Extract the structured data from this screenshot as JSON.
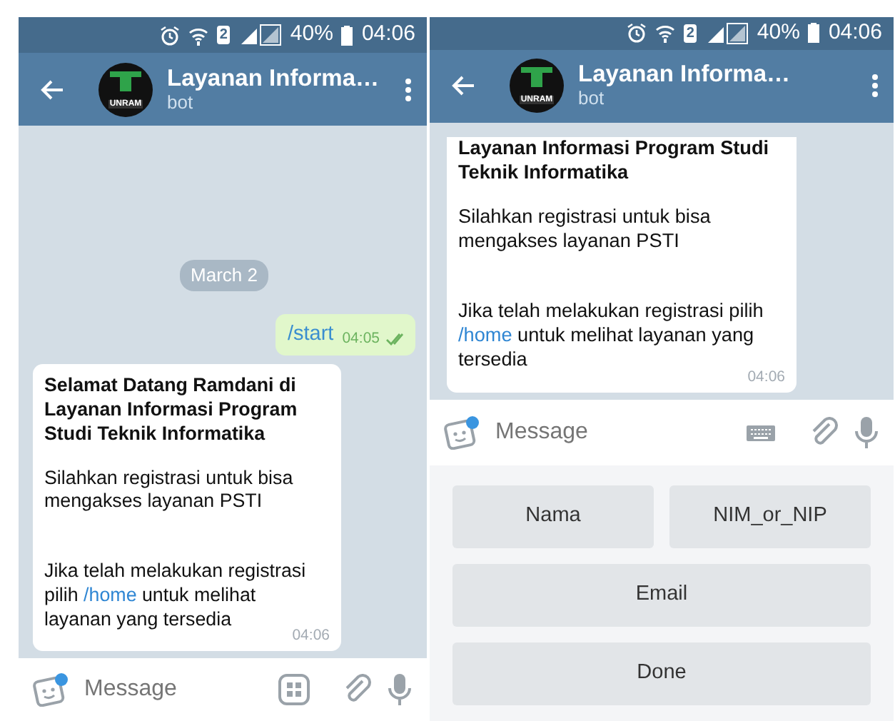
{
  "phones": [
    {
      "status_bar": {
        "battery": "40%",
        "time": "04:06",
        "sim": "2"
      },
      "header": {
        "title": "Layanan Informa…",
        "subtitle": "bot",
        "logo_text": "UNRAM"
      },
      "messages": [
        {
          "kind": "date",
          "text": "March 2"
        },
        {
          "kind": "outgoing",
          "text": "/start",
          "time": "04:05",
          "read": true
        },
        {
          "kind": "incoming",
          "time": "04:06",
          "paragraphs": [
            {
              "kind": "title",
              "text": "Selamat Datang Ramdani di Layanan Informasi Program Studi Teknik Informatika"
            },
            {
              "kind": "text",
              "text": "Silahkan registrasi untuk bisa mengakses layanan PSTI"
            },
            {
              "kind": "link",
              "before": "Jika telah melakukan registrasi pilih ",
              "link": "/home",
              "after": " untuk melihat layanan yang tersedia"
            }
          ]
        }
      ],
      "input": {
        "placeholder": "Message",
        "sticker_badge": true,
        "command_button": {
          "kind": "commands"
        }
      }
    },
    {
      "status_bar": {
        "battery": "40%",
        "time": "04:06",
        "sim": "2"
      },
      "header": {
        "title": "Layanan Informa…",
        "subtitle": "bot",
        "logo_text": "UNRAM"
      },
      "messages": [
        {
          "kind": "incoming",
          "time": "04:06",
          "cut_top": true,
          "paragraphs": [
            {
              "kind": "title",
              "text": "Layanan Informasi Program Studi Teknik Informatika"
            },
            {
              "kind": "text",
              "text": "Silahkan registrasi untuk bisa mengakses layanan PSTI"
            },
            {
              "kind": "link",
              "before": "Jika telah melakukan registrasi pilih ",
              "link": "/home",
              "after": " untuk melihat layanan yang tersedia"
            }
          ]
        }
      ],
      "input": {
        "placeholder": "Message",
        "sticker_badge": true,
        "command_button": {
          "kind": "keyboard"
        }
      },
      "keyboard_rows": [
        [
          "Nama",
          "NIM_or_NIP"
        ],
        [
          "Email"
        ],
        [
          "Done"
        ]
      ]
    }
  ]
}
